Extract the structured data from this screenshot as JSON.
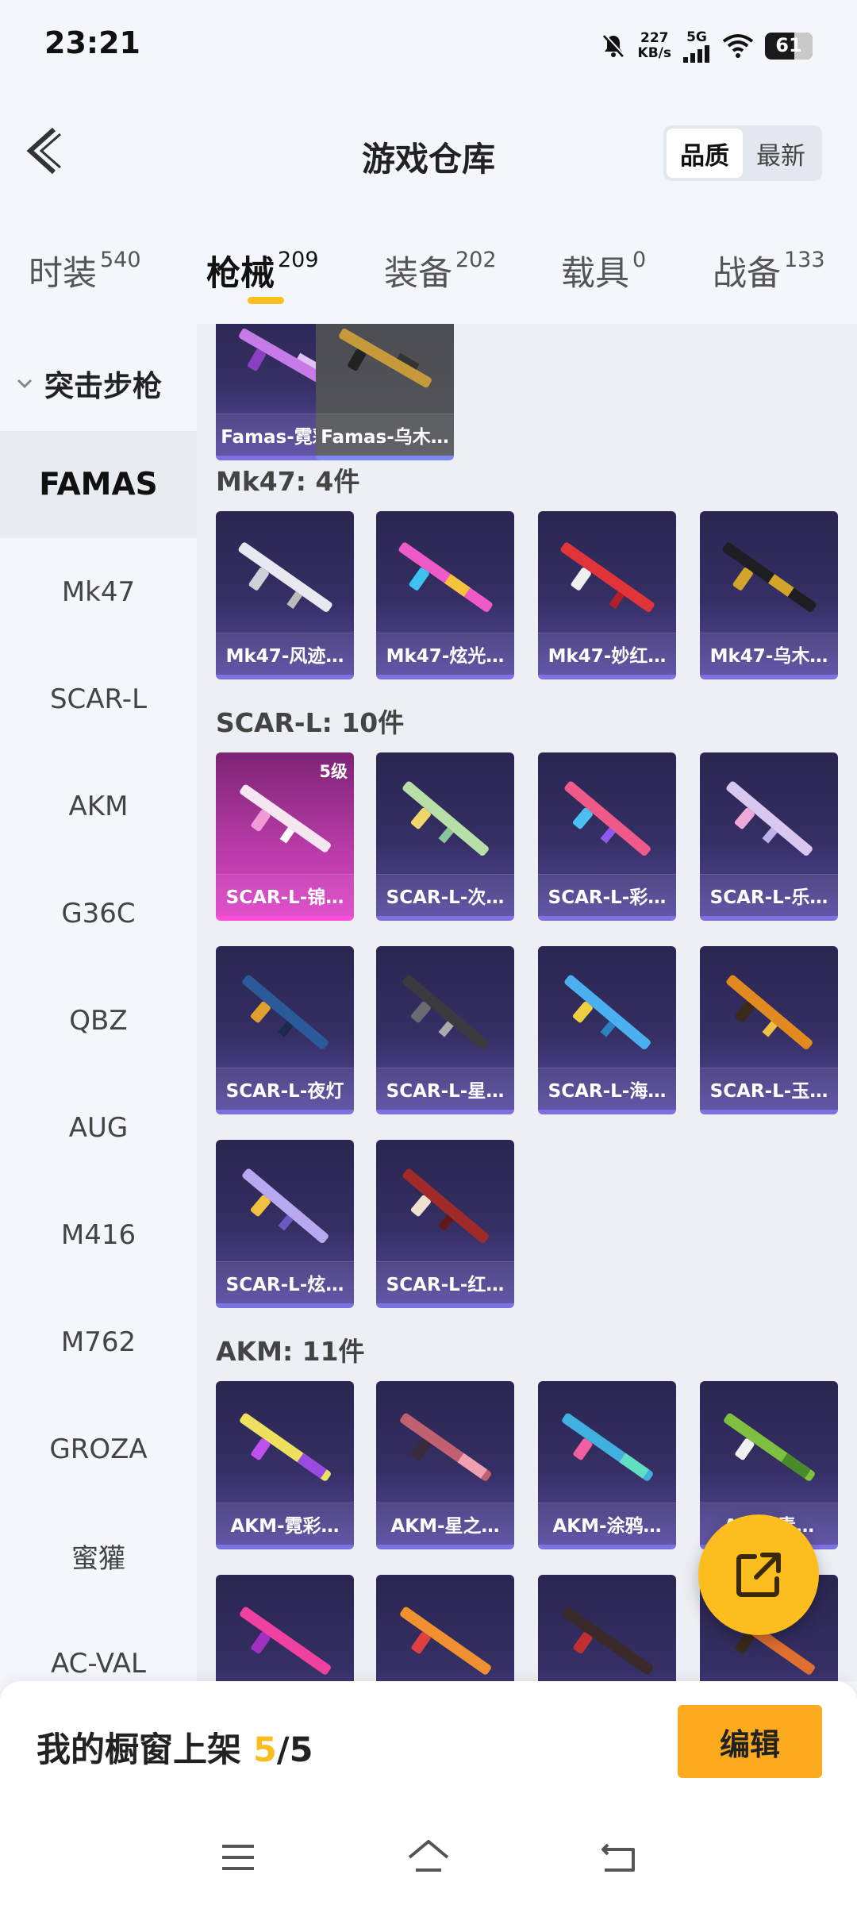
{
  "status": {
    "time": "23:21",
    "speed_value": "227",
    "speed_unit": "KB/s",
    "network": "5G",
    "battery": "61"
  },
  "header": {
    "title": "游戏仓库",
    "sort_quality": "品质",
    "sort_latest": "最新"
  },
  "tabs": [
    {
      "label": "时装",
      "count": "540"
    },
    {
      "label": "枪械",
      "count": "209"
    },
    {
      "label": "装备",
      "count": "202"
    },
    {
      "label": "载具",
      "count": "0"
    },
    {
      "label": "战备",
      "count": "133"
    }
  ],
  "sidebar": {
    "group": "突击步枪",
    "items": [
      "FAMAS",
      "Mk47",
      "SCAR-L",
      "AKM",
      "G36C",
      "QBZ",
      "AUG",
      "M416",
      "M762",
      "GROZA",
      "蜜獾",
      "AC-VAL"
    ]
  },
  "sections": {
    "famas": {
      "items": [
        {
          "name": "Famas-霓彩…"
        },
        {
          "name": "Famas-乌木…"
        }
      ]
    },
    "mk47": {
      "label": "Mk47: 4件",
      "items": [
        {
          "name": "Mk47-风迹…"
        },
        {
          "name": "Mk47-炫光…"
        },
        {
          "name": "Mk47-妙红…"
        },
        {
          "name": "Mk47-乌木…"
        }
      ]
    },
    "scarl": {
      "label": "SCAR-L: 10件",
      "items": [
        {
          "name": "SCAR-L-锦…",
          "badge": "5级"
        },
        {
          "name": "SCAR-L-次…"
        },
        {
          "name": "SCAR-L-彩…"
        },
        {
          "name": "SCAR-L-乐…"
        },
        {
          "name": "SCAR-L-夜灯"
        },
        {
          "name": "SCAR-L-星…"
        },
        {
          "name": "SCAR-L-海…"
        },
        {
          "name": "SCAR-L-玉…"
        },
        {
          "name": "SCAR-L-炫…"
        },
        {
          "name": "SCAR-L-红…"
        }
      ]
    },
    "akm": {
      "label": "AKM: 11件",
      "items": [
        {
          "name": "AKM-霓彩…"
        },
        {
          "name": "AKM-星之…"
        },
        {
          "name": "AKM-涂鸦…"
        },
        {
          "name": "AKM-青…"
        }
      ]
    }
  },
  "bottom": {
    "shelf_label": "我的橱窗上架",
    "shelf_current": "5",
    "shelf_total": "/5",
    "edit": "编辑"
  },
  "colors": {
    "accent": "#fcbd1e",
    "card_dark": "#2a2650",
    "card_legendary": "#b43aa5"
  },
  "icons": [
    "back-icon",
    "mute-icon",
    "signal-icon",
    "wifi-icon",
    "battery-icon",
    "chevron-down-icon",
    "share-icon",
    "menu-icon",
    "home-icon",
    "back-nav-icon"
  ]
}
